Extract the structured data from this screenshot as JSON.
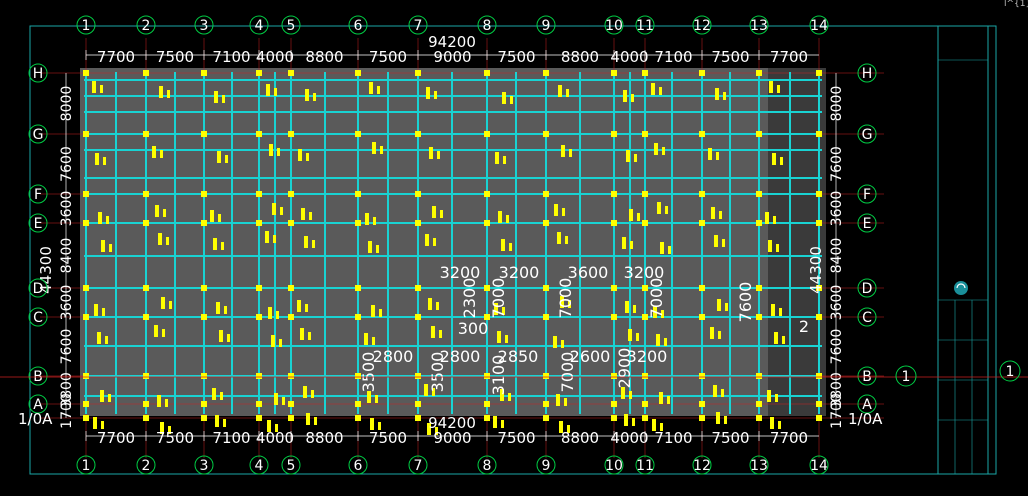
{
  "corner_label": "l^{1}",
  "axes": {
    "top_numbers": [
      "1",
      "2",
      "3",
      "4",
      "5",
      "6",
      "7",
      "8",
      "9",
      "10",
      "11",
      "12",
      "13",
      "14"
    ],
    "bottom_numbers": [
      "1",
      "2",
      "3",
      "4",
      "5",
      "6",
      "7",
      "8",
      "9",
      "10",
      "11",
      "12",
      "13",
      "14"
    ],
    "left_letters": [
      "H",
      "G",
      "F",
      "E",
      "D",
      "C",
      "B",
      "A",
      "1/0A"
    ],
    "right_letters": [
      "H",
      "G",
      "F",
      "E",
      "D",
      "C",
      "B",
      "A",
      "1/0A"
    ],
    "extra_right_axis": "1"
  },
  "dimensions": {
    "top_spans": [
      "7700",
      "7500",
      "7100",
      "4000",
      "8800",
      "7500",
      "9000",
      "7500",
      "8800",
      "4000",
      "7100",
      "7500",
      "7700"
    ],
    "top_total": "94200",
    "bottom_spans": [
      "7700",
      "7500",
      "7100",
      "4000",
      "8800",
      "7500",
      "9000",
      "7500",
      "8800",
      "4000",
      "7100",
      "7500",
      "7700"
    ],
    "bottom_total": "94200",
    "left_spans": [
      "8000",
      "7600",
      "3600",
      "8400",
      "3600",
      "7600",
      "3800",
      "1700"
    ],
    "left_total": "44300",
    "right_spans": [
      "8000",
      "7600",
      "3600",
      "8400",
      "3600",
      "7600",
      "3800",
      "1700"
    ],
    "right_total": "44300"
  },
  "interior_labels": [
    "3200",
    "3200",
    "3600",
    "3200",
    "2300",
    "300",
    "7000",
    "7000",
    "7000",
    "7600",
    "3500",
    "2800",
    "3500",
    "2800",
    "3100",
    "2850",
    "7000",
    "2600",
    "2900",
    "3200",
    "2"
  ],
  "colors": {
    "background": "#000000",
    "slab": "#5a5a5a",
    "beam": "#19d3d3",
    "annotation": "#ffff00",
    "axis_bubble": "#00cc44",
    "dimension": "#ffffff",
    "axis_line": "#cc2222",
    "frame": "#1aa6a6"
  }
}
